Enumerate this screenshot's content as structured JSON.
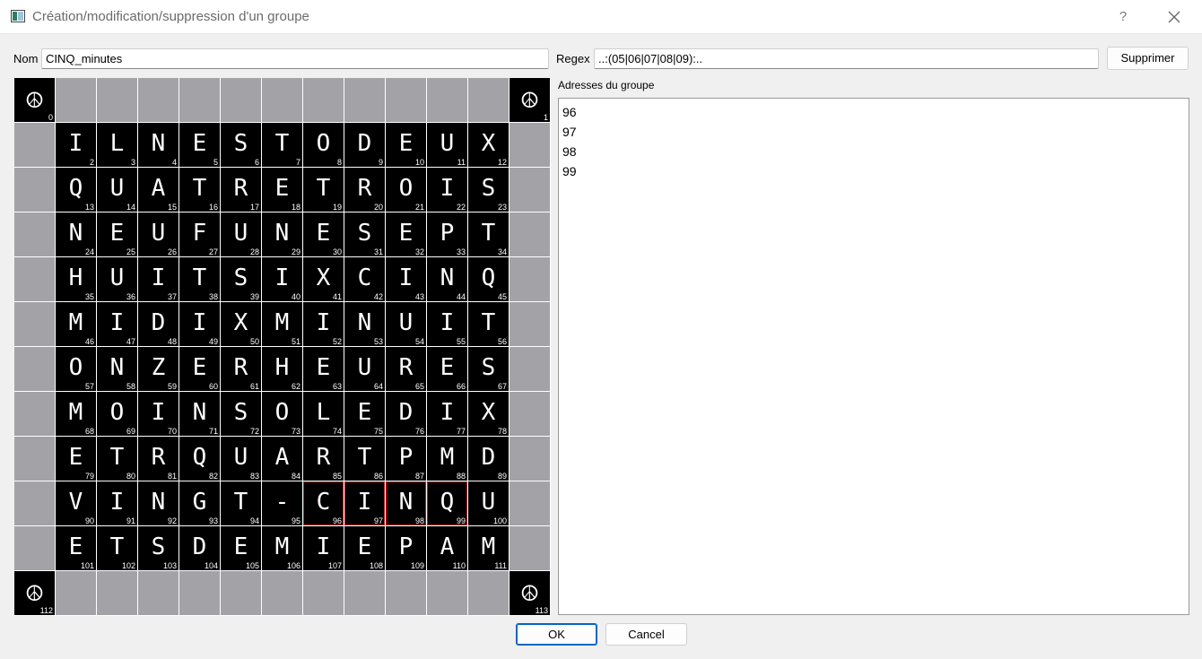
{
  "window": {
    "title": "Création/modification/suppression d'un groupe",
    "help_label": "?",
    "close_icon": "close-icon",
    "app_icon": "app-icon"
  },
  "form": {
    "name_label": "Nom",
    "name_value": "CINQ_minutes",
    "regex_label": "Regex",
    "regex_value": "..:(05|06|07|08|09):..",
    "delete_label": "Supprimer"
  },
  "addresses": {
    "label": "Adresses du groupe",
    "items": [
      "96",
      "97",
      "98",
      "99"
    ]
  },
  "grid": {
    "corners": [
      {
        "symbol": "☮",
        "icon": "peace-icon",
        "num": "0"
      },
      {
        "symbol": "☮",
        "icon": "peace-icon",
        "num": "1"
      },
      {
        "symbol": "☮",
        "icon": "peace-icon",
        "num": "112"
      },
      {
        "symbol": "☮",
        "icon": "peace-icon",
        "num": "113"
      }
    ],
    "rows": [
      "ILNESTODEUX",
      "QUATRETROIS",
      "NEUFUNESEPT",
      "HUITSIXCINQ",
      "MIDIXMINUIT",
      "ONZERHEURES",
      "MOINSOLEDIX",
      "ETRQUARTPMD",
      "VINGT-CINQU",
      "ETSDEMIEPAM"
    ],
    "first_number": 2,
    "selected": [
      96,
      97,
      98,
      99
    ],
    "selection_color": "#c0141c",
    "gray_color": "#a3a3a7"
  },
  "buttons": {
    "ok_label": "OK",
    "cancel_label": "Cancel"
  }
}
